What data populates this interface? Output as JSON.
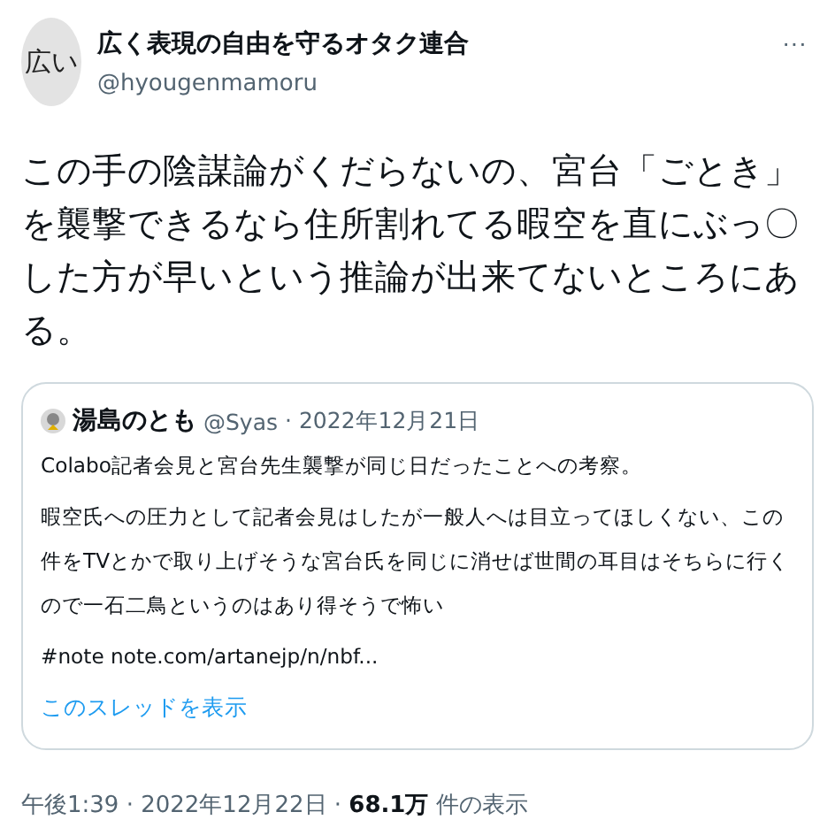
{
  "author": {
    "avatar_text": "広い",
    "name": "広く表現の自由を守るオタク連合",
    "handle": "@hyougenmamoru"
  },
  "more": "···",
  "body": "この手の陰謀論がくだらないの、宮台「ごとき」を襲撃できるなら住所割れてる暇空を直にぶっ〇した方が早いという推論が出来てないところにある。",
  "quote": {
    "name": "湯島のとも",
    "handle": "@Syas",
    "date": "· 2022年12月21日",
    "paragraphs": [
      "Colabo記者会見と宮台先生襲撃が同じ日だったことへの考察。",
      "暇空氏への圧力として記者会見はしたが一般人へは目立ってほしくない、この件をTVとかで取り上げそうな宮台氏を同じに消せば世間の耳目はそちらに行くので一石二鳥というのはあり得そうで怖い",
      "#note note.com/artanejp/n/nbf..."
    ],
    "thread_link": "このスレッドを表示"
  },
  "meta": "午後1:39 · 2022年12月22日 · **68.1万** 件の表示"
}
